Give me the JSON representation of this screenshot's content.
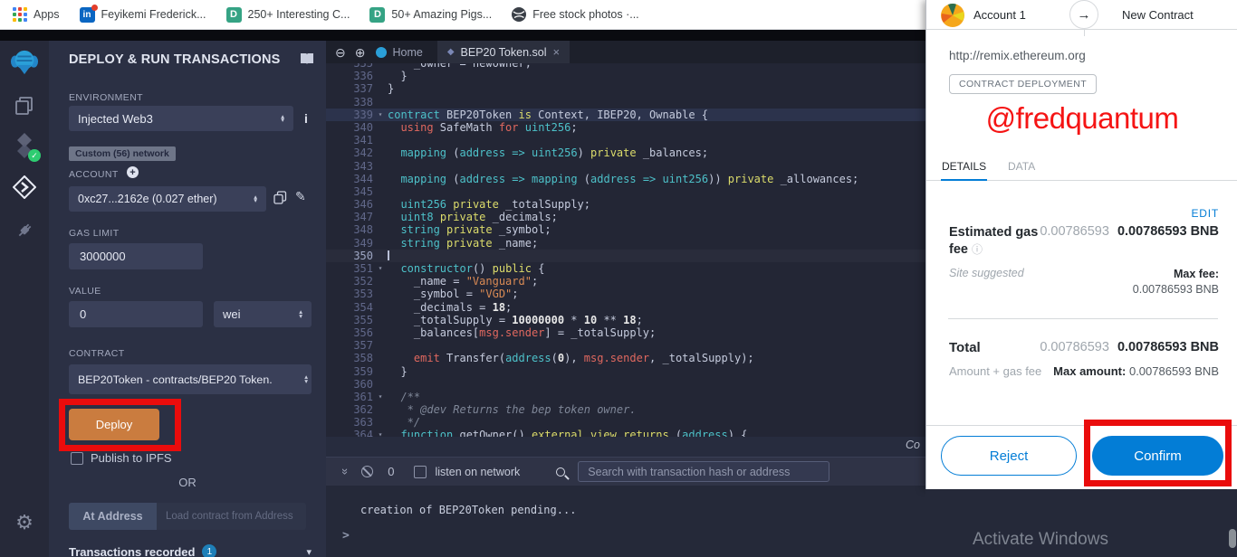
{
  "browser": {
    "bookmarks": [
      {
        "label": "Apps"
      },
      {
        "label": "Feyikemi Frederick...",
        "glyph": "in"
      },
      {
        "label": "250+ Interesting C...",
        "glyph": "D"
      },
      {
        "label": "50+ Amazing Pigs...",
        "glyph": "D"
      },
      {
        "label": "Free stock photos ·..."
      }
    ]
  },
  "icons": {
    "stepper_up": "▴",
    "stepper_down": "▾",
    "fold": "▾",
    "close_x": "×",
    "zoom_out": "⊖",
    "zoom_in": "⊕",
    "solidity_diamond": "◆",
    "double_chevron": "»",
    "info_i": "i",
    "info_circle": "ⓘ",
    "plus": "+",
    "pencil": "✎",
    "gear": "⚙",
    "arrow_right": "→",
    "chevron_down": "▾"
  },
  "deploy_panel": {
    "title": "DEPLOY & RUN TRANSACTIONS",
    "environment_label": "ENVIRONMENT",
    "environment_value": "Injected Web3",
    "network_badge": "Custom (56) network",
    "account_label": "ACCOUNT",
    "account_value": "0xc27...2162e (0.027 ether)",
    "gas_limit_label": "GAS LIMIT",
    "gas_limit_value": "3000000",
    "value_label": "VALUE",
    "value_value": "0",
    "value_unit": "wei",
    "contract_label": "CONTRACT",
    "contract_value": "BEP20Token - contracts/BEP20 Token.",
    "deploy_button": "Deploy",
    "publish_label": "Publish to IPFS",
    "or_label": "OR",
    "at_address_button": "At Address",
    "at_address_placeholder": "Load contract from Address",
    "transactions_label": "Transactions recorded",
    "transactions_count": "1"
  },
  "editor": {
    "home_tab": "Home",
    "file_tab": "BEP20 Token.sol",
    "corner_text": "Co",
    "lines": [
      {
        "n": 335,
        "toks": [
          [
            "d",
            "    _owner = newOwner;"
          ]
        ]
      },
      {
        "n": 336,
        "toks": [
          [
            "d",
            "  }"
          ]
        ]
      },
      {
        "n": 337,
        "toks": [
          [
            "d",
            "}"
          ]
        ]
      },
      {
        "n": 338,
        "toks": []
      },
      {
        "n": 339,
        "fold": true,
        "hl": true,
        "toks": [
          [
            "k",
            "contract"
          ],
          [
            "d",
            " BEP20Token "
          ],
          [
            "m",
            "is"
          ],
          [
            "d",
            " Context, IBEP20, Ownable {"
          ]
        ]
      },
      {
        "n": 340,
        "toks": [
          [
            "d",
            "  "
          ],
          [
            "o",
            "using"
          ],
          [
            "d",
            " SafeMath "
          ],
          [
            "o",
            "for"
          ],
          [
            "d",
            " "
          ],
          [
            "k",
            "uint256"
          ],
          [
            "d",
            ";"
          ]
        ]
      },
      {
        "n": 341,
        "toks": []
      },
      {
        "n": 342,
        "toks": [
          [
            "d",
            "  "
          ],
          [
            "k",
            "mapping"
          ],
          [
            "d",
            " ("
          ],
          [
            "k",
            "address"
          ],
          [
            "d",
            " "
          ],
          [
            "k",
            "=>"
          ],
          [
            "d",
            " "
          ],
          [
            "k",
            "uint256"
          ],
          [
            "d",
            ") "
          ],
          [
            "m",
            "private"
          ],
          [
            "d",
            " _balances;"
          ]
        ]
      },
      {
        "n": 343,
        "toks": []
      },
      {
        "n": 344,
        "toks": [
          [
            "d",
            "  "
          ],
          [
            "k",
            "mapping"
          ],
          [
            "d",
            " ("
          ],
          [
            "k",
            "address"
          ],
          [
            "d",
            " "
          ],
          [
            "k",
            "=>"
          ],
          [
            "d",
            " "
          ],
          [
            "k",
            "mapping"
          ],
          [
            "d",
            " ("
          ],
          [
            "k",
            "address"
          ],
          [
            "d",
            " "
          ],
          [
            "k",
            "=>"
          ],
          [
            "d",
            " "
          ],
          [
            "k",
            "uint256"
          ],
          [
            "d",
            ")) "
          ],
          [
            "m",
            "private"
          ],
          [
            "d",
            " _allowances;"
          ]
        ]
      },
      {
        "n": 345,
        "toks": []
      },
      {
        "n": 346,
        "toks": [
          [
            "d",
            "  "
          ],
          [
            "k",
            "uint256"
          ],
          [
            "d",
            " "
          ],
          [
            "m",
            "private"
          ],
          [
            "d",
            " _totalSupply;"
          ]
        ]
      },
      {
        "n": 347,
        "toks": [
          [
            "d",
            "  "
          ],
          [
            "k",
            "uint8"
          ],
          [
            "d",
            " "
          ],
          [
            "m",
            "private"
          ],
          [
            "d",
            " _decimals;"
          ]
        ]
      },
      {
        "n": 348,
        "toks": [
          [
            "d",
            "  "
          ],
          [
            "k",
            "string"
          ],
          [
            "d",
            " "
          ],
          [
            "m",
            "private"
          ],
          [
            "d",
            " _symbol;"
          ]
        ]
      },
      {
        "n": 349,
        "toks": [
          [
            "d",
            "  "
          ],
          [
            "k",
            "string"
          ],
          [
            "d",
            " "
          ],
          [
            "m",
            "private"
          ],
          [
            "d",
            " _name;"
          ]
        ]
      },
      {
        "n": 350,
        "cur": true,
        "toks": []
      },
      {
        "n": 351,
        "fold": true,
        "toks": [
          [
            "d",
            "  "
          ],
          [
            "k",
            "constructor"
          ],
          [
            "d",
            "() "
          ],
          [
            "m",
            "public"
          ],
          [
            "d",
            " {"
          ]
        ]
      },
      {
        "n": 352,
        "toks": [
          [
            "d",
            "    _name = "
          ],
          [
            "s",
            "\"Vanguard\""
          ],
          [
            "d",
            ";"
          ]
        ]
      },
      {
        "n": 353,
        "toks": [
          [
            "d",
            "    _symbol = "
          ],
          [
            "s",
            "\"VGD\""
          ],
          [
            "d",
            ";"
          ]
        ]
      },
      {
        "n": 354,
        "toks": [
          [
            "d",
            "    _decimals = "
          ],
          [
            "n",
            "18"
          ],
          [
            "d",
            ";"
          ]
        ]
      },
      {
        "n": 355,
        "toks": [
          [
            "d",
            "    _totalSupply = "
          ],
          [
            "n",
            "10000000"
          ],
          [
            "d",
            " * "
          ],
          [
            "n",
            "10"
          ],
          [
            "d",
            " ** "
          ],
          [
            "n",
            "18"
          ],
          [
            "d",
            ";"
          ]
        ]
      },
      {
        "n": 356,
        "toks": [
          [
            "d",
            "    _balances["
          ],
          [
            "o",
            "msg.sender"
          ],
          [
            "d",
            "] = _totalSupply;"
          ]
        ]
      },
      {
        "n": 357,
        "toks": []
      },
      {
        "n": 358,
        "toks": [
          [
            "d",
            "    "
          ],
          [
            "o",
            "emit"
          ],
          [
            "d",
            " Transfer("
          ],
          [
            "k",
            "address"
          ],
          [
            "d",
            "("
          ],
          [
            "n",
            "0"
          ],
          [
            "d",
            "), "
          ],
          [
            "o",
            "msg.sender"
          ],
          [
            "d",
            ", _totalSupply);"
          ]
        ]
      },
      {
        "n": 359,
        "toks": [
          [
            "d",
            "  }"
          ]
        ]
      },
      {
        "n": 360,
        "toks": []
      },
      {
        "n": 361,
        "fold": true,
        "toks": [
          [
            "c",
            "  /**"
          ]
        ]
      },
      {
        "n": 362,
        "toks": [
          [
            "c",
            "   * @dev Returns the bep token owner."
          ]
        ]
      },
      {
        "n": 363,
        "toks": [
          [
            "c",
            "   */"
          ]
        ]
      },
      {
        "n": 364,
        "fold": true,
        "toks": [
          [
            "d",
            "  "
          ],
          [
            "k",
            "function"
          ],
          [
            "d",
            " getOwner() "
          ],
          [
            "m",
            "external"
          ],
          [
            "d",
            " "
          ],
          [
            "m",
            "view"
          ],
          [
            "d",
            " "
          ],
          [
            "m",
            "returns"
          ],
          [
            "d",
            " ("
          ],
          [
            "k",
            "address"
          ],
          [
            "d",
            ") {"
          ]
        ]
      }
    ]
  },
  "terminal": {
    "count": "0",
    "listen_label": "listen on network",
    "search_placeholder": "Search with transaction hash or address",
    "log_line": "creation of BEP20Token pending...",
    "prompt": ">"
  },
  "metamask": {
    "from_account": "Account 1",
    "to_label": "New Contract",
    "origin": "http://remix.ethereum.org",
    "type_badge": "CONTRACT DEPLOYMENT",
    "watermark": "@fredquantum",
    "tabs": {
      "details": "DETAILS",
      "data": "DATA"
    },
    "edit_link": "EDIT",
    "gas": {
      "label": "Estimated gas fee",
      "value_secondary": "0.00786593",
      "value_primary": "0.00786593 BNB",
      "site_suggested": "Site suggested",
      "max_fee_label": "Max fee:",
      "max_fee_value": "0.00786593 BNB"
    },
    "total": {
      "label": "Total",
      "value_secondary": "0.00786593",
      "value_primary": "0.00786593 BNB",
      "sub_label": "Amount + gas fee",
      "max_amount_label": "Max amount:",
      "max_amount_value": "0.00786593 BNB"
    },
    "reject_button": "Reject",
    "confirm_button": "Confirm"
  },
  "os_watermark": "Activate Windows",
  "colors": {
    "metamask_accent": "#037dd6",
    "deploy_orange": "#ca7c3f",
    "annotation_red": "#ea0c0c",
    "watermark_red": "#f51414",
    "remix_panel": "#2b3044"
  }
}
